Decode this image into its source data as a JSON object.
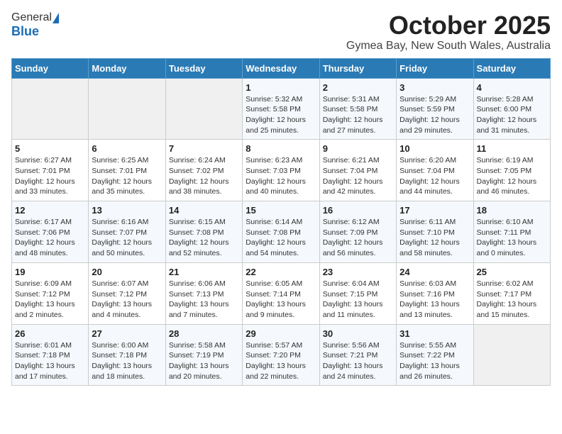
{
  "logo": {
    "general": "General",
    "blue": "Blue"
  },
  "header": {
    "month": "October 2025",
    "location": "Gymea Bay, New South Wales, Australia"
  },
  "days_of_week": [
    "Sunday",
    "Monday",
    "Tuesday",
    "Wednesday",
    "Thursday",
    "Friday",
    "Saturday"
  ],
  "weeks": [
    [
      {
        "day": "",
        "info": ""
      },
      {
        "day": "",
        "info": ""
      },
      {
        "day": "",
        "info": ""
      },
      {
        "day": "1",
        "info": "Sunrise: 5:32 AM\nSunset: 5:58 PM\nDaylight: 12 hours\nand 25 minutes."
      },
      {
        "day": "2",
        "info": "Sunrise: 5:31 AM\nSunset: 5:58 PM\nDaylight: 12 hours\nand 27 minutes."
      },
      {
        "day": "3",
        "info": "Sunrise: 5:29 AM\nSunset: 5:59 PM\nDaylight: 12 hours\nand 29 minutes."
      },
      {
        "day": "4",
        "info": "Sunrise: 5:28 AM\nSunset: 6:00 PM\nDaylight: 12 hours\nand 31 minutes."
      }
    ],
    [
      {
        "day": "5",
        "info": "Sunrise: 6:27 AM\nSunset: 7:01 PM\nDaylight: 12 hours\nand 33 minutes."
      },
      {
        "day": "6",
        "info": "Sunrise: 6:25 AM\nSunset: 7:01 PM\nDaylight: 12 hours\nand 35 minutes."
      },
      {
        "day": "7",
        "info": "Sunrise: 6:24 AM\nSunset: 7:02 PM\nDaylight: 12 hours\nand 38 minutes."
      },
      {
        "day": "8",
        "info": "Sunrise: 6:23 AM\nSunset: 7:03 PM\nDaylight: 12 hours\nand 40 minutes."
      },
      {
        "day": "9",
        "info": "Sunrise: 6:21 AM\nSunset: 7:04 PM\nDaylight: 12 hours\nand 42 minutes."
      },
      {
        "day": "10",
        "info": "Sunrise: 6:20 AM\nSunset: 7:04 PM\nDaylight: 12 hours\nand 44 minutes."
      },
      {
        "day": "11",
        "info": "Sunrise: 6:19 AM\nSunset: 7:05 PM\nDaylight: 12 hours\nand 46 minutes."
      }
    ],
    [
      {
        "day": "12",
        "info": "Sunrise: 6:17 AM\nSunset: 7:06 PM\nDaylight: 12 hours\nand 48 minutes."
      },
      {
        "day": "13",
        "info": "Sunrise: 6:16 AM\nSunset: 7:07 PM\nDaylight: 12 hours\nand 50 minutes."
      },
      {
        "day": "14",
        "info": "Sunrise: 6:15 AM\nSunset: 7:08 PM\nDaylight: 12 hours\nand 52 minutes."
      },
      {
        "day": "15",
        "info": "Sunrise: 6:14 AM\nSunset: 7:08 PM\nDaylight: 12 hours\nand 54 minutes."
      },
      {
        "day": "16",
        "info": "Sunrise: 6:12 AM\nSunset: 7:09 PM\nDaylight: 12 hours\nand 56 minutes."
      },
      {
        "day": "17",
        "info": "Sunrise: 6:11 AM\nSunset: 7:10 PM\nDaylight: 12 hours\nand 58 minutes."
      },
      {
        "day": "18",
        "info": "Sunrise: 6:10 AM\nSunset: 7:11 PM\nDaylight: 13 hours\nand 0 minutes."
      }
    ],
    [
      {
        "day": "19",
        "info": "Sunrise: 6:09 AM\nSunset: 7:12 PM\nDaylight: 13 hours\nand 2 minutes."
      },
      {
        "day": "20",
        "info": "Sunrise: 6:07 AM\nSunset: 7:12 PM\nDaylight: 13 hours\nand 4 minutes."
      },
      {
        "day": "21",
        "info": "Sunrise: 6:06 AM\nSunset: 7:13 PM\nDaylight: 13 hours\nand 7 minutes."
      },
      {
        "day": "22",
        "info": "Sunrise: 6:05 AM\nSunset: 7:14 PM\nDaylight: 13 hours\nand 9 minutes."
      },
      {
        "day": "23",
        "info": "Sunrise: 6:04 AM\nSunset: 7:15 PM\nDaylight: 13 hours\nand 11 minutes."
      },
      {
        "day": "24",
        "info": "Sunrise: 6:03 AM\nSunset: 7:16 PM\nDaylight: 13 hours\nand 13 minutes."
      },
      {
        "day": "25",
        "info": "Sunrise: 6:02 AM\nSunset: 7:17 PM\nDaylight: 13 hours\nand 15 minutes."
      }
    ],
    [
      {
        "day": "26",
        "info": "Sunrise: 6:01 AM\nSunset: 7:18 PM\nDaylight: 13 hours\nand 17 minutes."
      },
      {
        "day": "27",
        "info": "Sunrise: 6:00 AM\nSunset: 7:18 PM\nDaylight: 13 hours\nand 18 minutes."
      },
      {
        "day": "28",
        "info": "Sunrise: 5:58 AM\nSunset: 7:19 PM\nDaylight: 13 hours\nand 20 minutes."
      },
      {
        "day": "29",
        "info": "Sunrise: 5:57 AM\nSunset: 7:20 PM\nDaylight: 13 hours\nand 22 minutes."
      },
      {
        "day": "30",
        "info": "Sunrise: 5:56 AM\nSunset: 7:21 PM\nDaylight: 13 hours\nand 24 minutes."
      },
      {
        "day": "31",
        "info": "Sunrise: 5:55 AM\nSunset: 7:22 PM\nDaylight: 13 hours\nand 26 minutes."
      },
      {
        "day": "",
        "info": ""
      }
    ]
  ]
}
